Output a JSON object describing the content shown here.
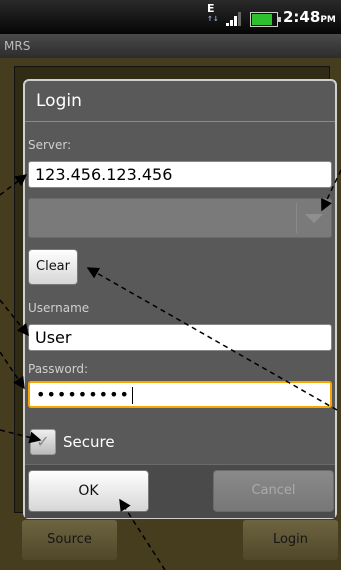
{
  "status_bar": {
    "network": "E",
    "time": "2:48",
    "ampm": "PM",
    "battery_color": "#2ec12e"
  },
  "app": {
    "title": "MRS",
    "bottom_left_button": "Source",
    "bottom_right_button": "Login"
  },
  "dialog": {
    "title": "Login",
    "server_label": "Server:",
    "server_value": "123.456.123.456",
    "clear_button": "Clear",
    "username_label": "Username",
    "username_value": "User",
    "password_label": "Password:",
    "password_masked": "•••••••••",
    "secure_label": "Secure",
    "ok_button": "OK",
    "cancel_button": "Cancel"
  },
  "icons": {
    "checkbox": "checkmark-icon",
    "spinner": "dropdown-arrow-icon"
  }
}
